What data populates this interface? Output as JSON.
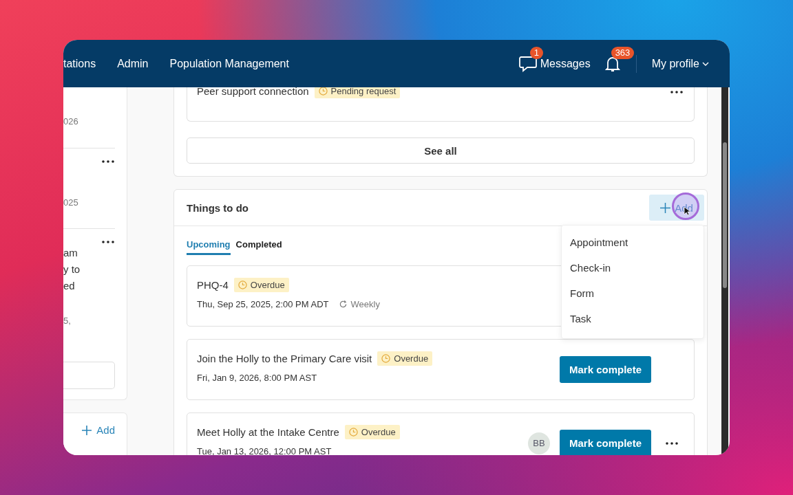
{
  "nav": {
    "items": [
      {
        "label": "tations",
        "selected": false
      },
      {
        "label": "Admin",
        "selected": false
      },
      {
        "label": "Population Management",
        "selected": false
      }
    ],
    "messages": {
      "label": "Messages",
      "count": "1"
    },
    "notifications": {
      "count": "363"
    },
    "profile": {
      "label": "My profile"
    }
  },
  "left_panel": {
    "entries": [
      {
        "meta": "026",
        "menu": false
      },
      {
        "meta": "025",
        "menu": true
      },
      {
        "lines": [
          "am",
          "y to",
          "ed"
        ],
        "meta": "5,",
        "menu": true
      }
    ],
    "add_label": "Add"
  },
  "top_card": {
    "item": {
      "title": "Peer support connection",
      "status": "Pending request",
      "menu": true
    },
    "see_all": "See all"
  },
  "todo": {
    "title": "Things to do",
    "add_label": "Add",
    "tabs": [
      {
        "label": "Upcoming",
        "selected": true
      },
      {
        "label": "Completed",
        "selected": false
      }
    ],
    "items": [
      {
        "title": "PHQ-4",
        "status": "Overdue",
        "when": "Thu, Sep 25, 2025, 2:00 PM ADT",
        "repeat": "Weekly",
        "menu": false
      },
      {
        "title": "Join the Holly to the Primary Care visit",
        "status": "Overdue",
        "when": "Fri, Jan 9, 2026, 8:00 PM AST",
        "action": "Mark complete",
        "menu": false
      },
      {
        "title": "Meet Holly at the Intake Centre",
        "status": "Overdue",
        "when": "Tue, Jan 13, 2026, 12:00 PM AST",
        "assignee": "BB",
        "action": "Mark complete",
        "menu": true
      }
    ],
    "add_menu": {
      "open": true,
      "options": [
        "Appointment",
        "Check-in",
        "Form",
        "Task"
      ]
    }
  }
}
